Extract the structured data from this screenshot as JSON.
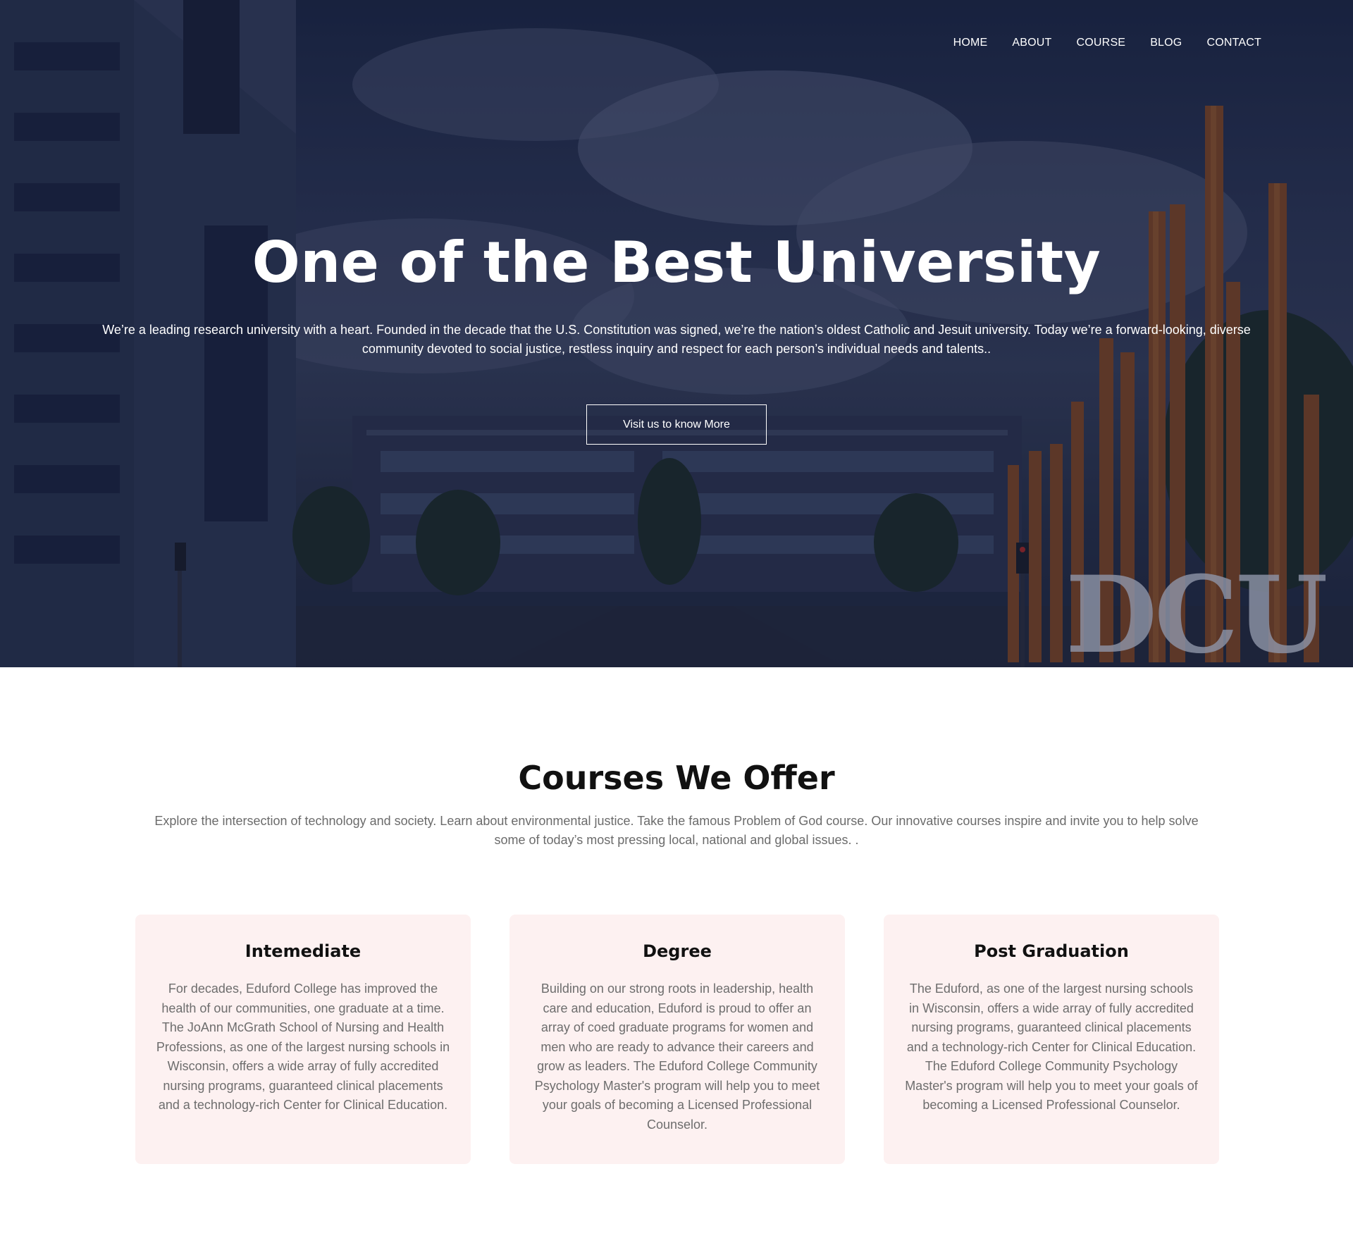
{
  "nav": {
    "items": [
      {
        "label": "HOME"
      },
      {
        "label": "ABOUT"
      },
      {
        "label": "COURSE"
      },
      {
        "label": "BLOG"
      },
      {
        "label": "CONTACT"
      }
    ]
  },
  "hero": {
    "title": "One of the Best University",
    "description": "We’re a leading research university with a heart. Founded in the decade that the U.S. Constitution was signed, we’re the nation’s oldest Catholic and Jesuit university. Today we’re a forward-looking, diverse community devoted to social justice, restless inquiry and respect for each person’s individual needs and talents..",
    "button_label": "Visit us to know More",
    "sign_text": "DCU"
  },
  "courses": {
    "title": "Courses We Offer",
    "intro": "Explore the intersection of technology and society. Learn about environmental justice. Take the famous Problem of God course. Our innovative courses inspire and invite you to help solve some of today’s most pressing local, national and global issues. .",
    "cards": [
      {
        "title": "Intemediate",
        "text": "For decades, Eduford College has improved the health of our communities, one graduate at a time. The JoAnn McGrath School of Nursing and Health Professions, as one of the largest nursing schools in Wisconsin, offers a wide array of fully accredited nursing programs, guaranteed clinical placements and a technology-rich Center for Clinical Education."
      },
      {
        "title": "Degree",
        "text": "Building on our strong roots in leadership, health care and education, Eduford is proud to offer an array of coed graduate programs for women and men who are ready to advance their careers and grow as leaders. The Eduford College Community Psychology Master's program will help you to meet your goals of becoming a Licensed Professional Counselor."
      },
      {
        "title": "Post Graduation",
        "text": "The Eduford, as one of the largest nursing schools in Wisconsin, offers a wide array of fully accredited nursing programs, guaranteed clinical placements and a technology-rich Center for Clinical Education. The Eduford College Community Psychology Master's program will help you to meet your goals of becoming a Licensed Professional Counselor."
      }
    ]
  },
  "colors": {
    "hero_overlay": "#1c2745",
    "card_background": "#fdf1f1",
    "heading": "#111111",
    "body_text": "#6b6b6b",
    "accent_rust": "#8a4a22"
  }
}
